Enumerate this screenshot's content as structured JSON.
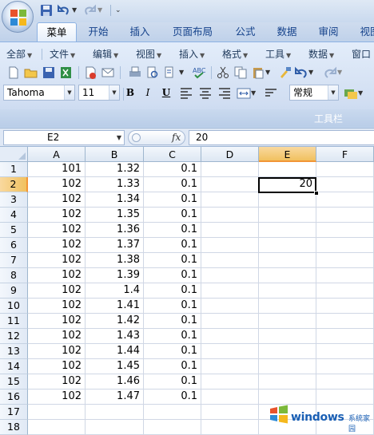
{
  "titlebar": {
    "office_button": "office-button"
  },
  "tabs": [
    {
      "label": "菜单",
      "active": true
    },
    {
      "label": "开始"
    },
    {
      "label": "插入"
    },
    {
      "label": "页面布局"
    },
    {
      "label": "公式"
    },
    {
      "label": "数据"
    },
    {
      "label": "审阅"
    },
    {
      "label": "视图"
    }
  ],
  "menu": [
    "全部",
    "文件",
    "编辑",
    "视图",
    "插入",
    "格式",
    "工具",
    "数据",
    "窗口"
  ],
  "format": {
    "font": "Tahoma",
    "size": "11",
    "bold": "B",
    "italic": "I",
    "underline": "U",
    "number_format": "常规"
  },
  "toolbar_caption": "工具栏",
  "formula_bar": {
    "name_box": "E2",
    "fx": "fx",
    "value": "20"
  },
  "columns": [
    "A",
    "B",
    "C",
    "D",
    "E",
    "F"
  ],
  "selected_column": "E",
  "rows": [
    {
      "n": "1",
      "A": "101",
      "B": "1.32",
      "C": "0.1",
      "E": ""
    },
    {
      "n": "2",
      "A": "102",
      "B": "1.33",
      "C": "0.1",
      "E": "20"
    },
    {
      "n": "3",
      "A": "102",
      "B": "1.34",
      "C": "0.1",
      "E": ""
    },
    {
      "n": "4",
      "A": "102",
      "B": "1.35",
      "C": "0.1",
      "E": ""
    },
    {
      "n": "5",
      "A": "102",
      "B": "1.36",
      "C": "0.1",
      "E": ""
    },
    {
      "n": "6",
      "A": "102",
      "B": "1.37",
      "C": "0.1",
      "E": ""
    },
    {
      "n": "7",
      "A": "102",
      "B": "1.38",
      "C": "0.1",
      "E": ""
    },
    {
      "n": "8",
      "A": "102",
      "B": "1.39",
      "C": "0.1",
      "E": ""
    },
    {
      "n": "9",
      "A": "102",
      "B": "1.4",
      "C": "0.1",
      "E": ""
    },
    {
      "n": "10",
      "A": "102",
      "B": "1.41",
      "C": "0.1",
      "E": ""
    },
    {
      "n": "11",
      "A": "102",
      "B": "1.42",
      "C": "0.1",
      "E": ""
    },
    {
      "n": "12",
      "A": "102",
      "B": "1.43",
      "C": "0.1",
      "E": ""
    },
    {
      "n": "13",
      "A": "102",
      "B": "1.44",
      "C": "0.1",
      "E": ""
    },
    {
      "n": "14",
      "A": "102",
      "B": "1.45",
      "C": "0.1",
      "E": ""
    },
    {
      "n": "15",
      "A": "102",
      "B": "1.46",
      "C": "0.1",
      "E": ""
    },
    {
      "n": "16",
      "A": "102",
      "B": "1.47",
      "C": "0.1",
      "E": ""
    },
    {
      "n": "17",
      "A": "",
      "B": "",
      "C": "",
      "E": ""
    },
    {
      "n": "18",
      "A": "",
      "B": "",
      "C": "",
      "E": ""
    }
  ],
  "selected_row": "2",
  "watermark": {
    "text": "windows",
    "sub": "系统家园"
  },
  "colors": {
    "accent": "#15428b",
    "selection": "#f1c15f",
    "ribbon": "#d1def2"
  }
}
